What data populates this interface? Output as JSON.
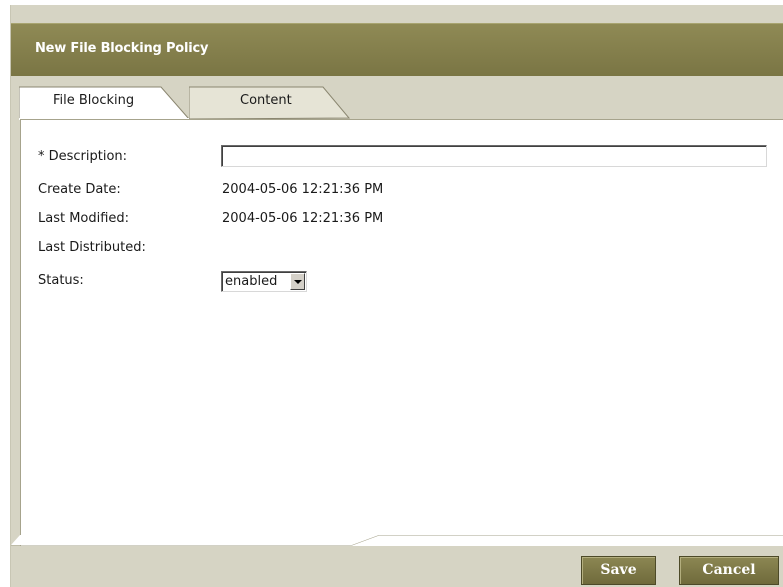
{
  "window": {
    "title": "New File Blocking Policy"
  },
  "tabs": [
    {
      "label": "File Blocking",
      "active": true
    },
    {
      "label": "Content",
      "active": false
    }
  ],
  "form": {
    "description_label": "* Description:",
    "description_value": "",
    "create_date_label": "Create Date:",
    "create_date_value": "2004-05-06 12:21:36 PM",
    "last_modified_label": "Last Modified:",
    "last_modified_value": "2004-05-06 12:21:36 PM",
    "last_distributed_label": "Last Distributed:",
    "last_distributed_value": "",
    "status_label": "Status:",
    "status_value": "enabled"
  },
  "actions": {
    "save_label": "Save",
    "cancel_label": "Cancel"
  },
  "colors": {
    "title_bar": "#7f7a48",
    "panel_background": "#d6d4c4",
    "button": "#7d7847"
  }
}
